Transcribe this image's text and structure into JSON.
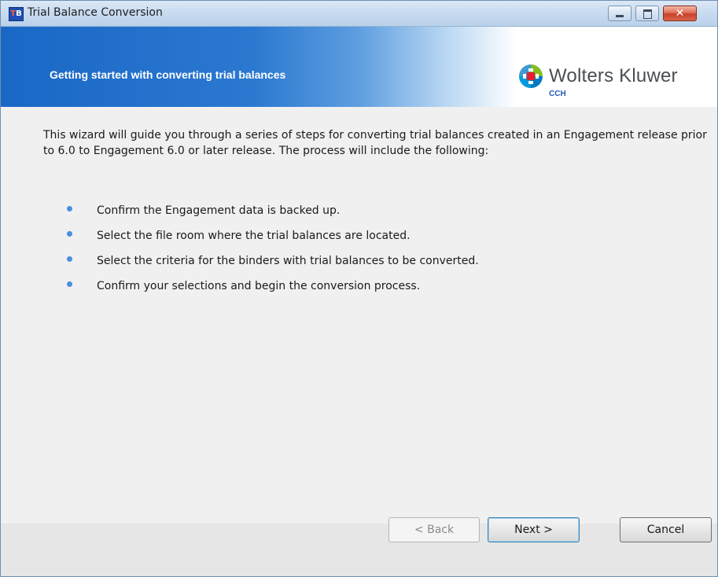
{
  "window": {
    "title": "Trial Balance Conversion",
    "icon_label": "TB"
  },
  "banner": {
    "title": "Getting started with converting trial balances",
    "logo_text": "Wolters Kluwer",
    "logo_subtext": "CCH"
  },
  "content": {
    "intro": "This wizard will guide you through a series of steps for converting  trial balances created in an Engagement release prior to 6.0 to Engagement 6.0 or later release. The process will include the following:",
    "steps": [
      "Confirm the Engagement data is backed up.",
      "Select the file room where the trial balances are located.",
      "Select the criteria for the binders with trial balances to be converted.",
      "Confirm your selections and begin the conversion process."
    ]
  },
  "buttons": {
    "back": "< Back",
    "next": "Next >",
    "cancel": "Cancel"
  },
  "icons": {
    "app": "app-icon",
    "minimize": "minimize-icon",
    "maximize": "maximize-icon",
    "close": "close-icon",
    "logo": "wolters-kluwer-logo-icon",
    "bullet": "bullet-icon"
  },
  "colors": {
    "banner_blue": "#1a68c6",
    "bullet_blue": "#4a8ee0",
    "close_red": "#c7402a"
  }
}
